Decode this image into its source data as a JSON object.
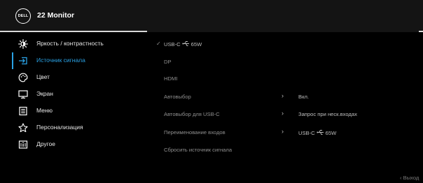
{
  "header": {
    "logo_text": "DELL",
    "title": "22 Monitor"
  },
  "sidebar": {
    "items": [
      {
        "label": "Яркость / контрастность",
        "icon": "brightness-icon"
      },
      {
        "label": "Источник сигнала",
        "icon": "input-source-icon",
        "active": true
      },
      {
        "label": "Цвет",
        "icon": "color-palette-icon"
      },
      {
        "label": "Экран",
        "icon": "display-monitor-icon"
      },
      {
        "label": "Меню",
        "icon": "menu-list-icon"
      },
      {
        "label": "Персонализация",
        "icon": "star-icon"
      },
      {
        "label": "Другое",
        "icon": "info-icon"
      }
    ]
  },
  "options": {
    "usbc_prefix": "USB-C",
    "usbc_suffix": "65W",
    "dp": "DP",
    "hdmi": "HDMI",
    "auto_select": "Автовыбор",
    "auto_select_value": "Вкл.",
    "auto_select_usbc": "Автовыбор для USB-C",
    "auto_select_usbc_value": "Запрос при неск.входах",
    "rename_inputs": "Переименование входов",
    "rename_value_prefix": "USB-C",
    "rename_value_suffix": "65W",
    "reset": "Сбросить  источник сигнала"
  },
  "footer": {
    "exit": "Выход"
  },
  "colors": {
    "accent": "#2aa2e5",
    "header_bg": "#141414",
    "background": "#000000"
  }
}
